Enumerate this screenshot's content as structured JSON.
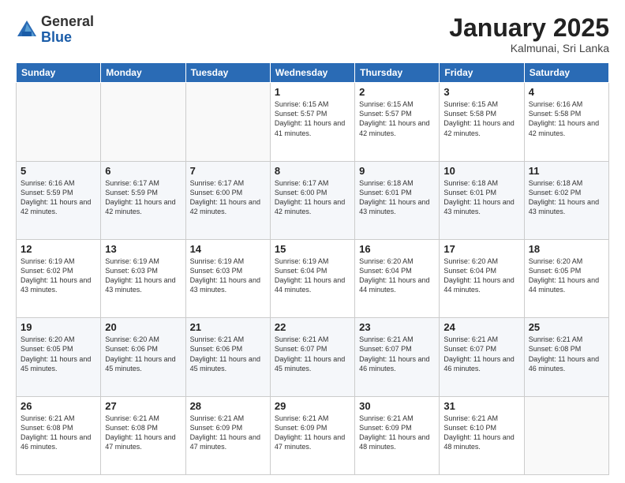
{
  "logo": {
    "general": "General",
    "blue": "Blue"
  },
  "header": {
    "month": "January 2025",
    "location": "Kalmunai, Sri Lanka"
  },
  "weekdays": [
    "Sunday",
    "Monday",
    "Tuesday",
    "Wednesday",
    "Thursday",
    "Friday",
    "Saturday"
  ],
  "weeks": [
    [
      {
        "day": "",
        "info": ""
      },
      {
        "day": "",
        "info": ""
      },
      {
        "day": "",
        "info": ""
      },
      {
        "day": "1",
        "info": "Sunrise: 6:15 AM\nSunset: 5:57 PM\nDaylight: 11 hours\nand 41 minutes."
      },
      {
        "day": "2",
        "info": "Sunrise: 6:15 AM\nSunset: 5:57 PM\nDaylight: 11 hours\nand 42 minutes."
      },
      {
        "day": "3",
        "info": "Sunrise: 6:15 AM\nSunset: 5:58 PM\nDaylight: 11 hours\nand 42 minutes."
      },
      {
        "day": "4",
        "info": "Sunrise: 6:16 AM\nSunset: 5:58 PM\nDaylight: 11 hours\nand 42 minutes."
      }
    ],
    [
      {
        "day": "5",
        "info": "Sunrise: 6:16 AM\nSunset: 5:59 PM\nDaylight: 11 hours\nand 42 minutes."
      },
      {
        "day": "6",
        "info": "Sunrise: 6:17 AM\nSunset: 5:59 PM\nDaylight: 11 hours\nand 42 minutes."
      },
      {
        "day": "7",
        "info": "Sunrise: 6:17 AM\nSunset: 6:00 PM\nDaylight: 11 hours\nand 42 minutes."
      },
      {
        "day": "8",
        "info": "Sunrise: 6:17 AM\nSunset: 6:00 PM\nDaylight: 11 hours\nand 42 minutes."
      },
      {
        "day": "9",
        "info": "Sunrise: 6:18 AM\nSunset: 6:01 PM\nDaylight: 11 hours\nand 43 minutes."
      },
      {
        "day": "10",
        "info": "Sunrise: 6:18 AM\nSunset: 6:01 PM\nDaylight: 11 hours\nand 43 minutes."
      },
      {
        "day": "11",
        "info": "Sunrise: 6:18 AM\nSunset: 6:02 PM\nDaylight: 11 hours\nand 43 minutes."
      }
    ],
    [
      {
        "day": "12",
        "info": "Sunrise: 6:19 AM\nSunset: 6:02 PM\nDaylight: 11 hours\nand 43 minutes."
      },
      {
        "day": "13",
        "info": "Sunrise: 6:19 AM\nSunset: 6:03 PM\nDaylight: 11 hours\nand 43 minutes."
      },
      {
        "day": "14",
        "info": "Sunrise: 6:19 AM\nSunset: 6:03 PM\nDaylight: 11 hours\nand 43 minutes."
      },
      {
        "day": "15",
        "info": "Sunrise: 6:19 AM\nSunset: 6:04 PM\nDaylight: 11 hours\nand 44 minutes."
      },
      {
        "day": "16",
        "info": "Sunrise: 6:20 AM\nSunset: 6:04 PM\nDaylight: 11 hours\nand 44 minutes."
      },
      {
        "day": "17",
        "info": "Sunrise: 6:20 AM\nSunset: 6:04 PM\nDaylight: 11 hours\nand 44 minutes."
      },
      {
        "day": "18",
        "info": "Sunrise: 6:20 AM\nSunset: 6:05 PM\nDaylight: 11 hours\nand 44 minutes."
      }
    ],
    [
      {
        "day": "19",
        "info": "Sunrise: 6:20 AM\nSunset: 6:05 PM\nDaylight: 11 hours\nand 45 minutes."
      },
      {
        "day": "20",
        "info": "Sunrise: 6:20 AM\nSunset: 6:06 PM\nDaylight: 11 hours\nand 45 minutes."
      },
      {
        "day": "21",
        "info": "Sunrise: 6:21 AM\nSunset: 6:06 PM\nDaylight: 11 hours\nand 45 minutes."
      },
      {
        "day": "22",
        "info": "Sunrise: 6:21 AM\nSunset: 6:07 PM\nDaylight: 11 hours\nand 45 minutes."
      },
      {
        "day": "23",
        "info": "Sunrise: 6:21 AM\nSunset: 6:07 PM\nDaylight: 11 hours\nand 46 minutes."
      },
      {
        "day": "24",
        "info": "Sunrise: 6:21 AM\nSunset: 6:07 PM\nDaylight: 11 hours\nand 46 minutes."
      },
      {
        "day": "25",
        "info": "Sunrise: 6:21 AM\nSunset: 6:08 PM\nDaylight: 11 hours\nand 46 minutes."
      }
    ],
    [
      {
        "day": "26",
        "info": "Sunrise: 6:21 AM\nSunset: 6:08 PM\nDaylight: 11 hours\nand 46 minutes."
      },
      {
        "day": "27",
        "info": "Sunrise: 6:21 AM\nSunset: 6:08 PM\nDaylight: 11 hours\nand 47 minutes."
      },
      {
        "day": "28",
        "info": "Sunrise: 6:21 AM\nSunset: 6:09 PM\nDaylight: 11 hours\nand 47 minutes."
      },
      {
        "day": "29",
        "info": "Sunrise: 6:21 AM\nSunset: 6:09 PM\nDaylight: 11 hours\nand 47 minutes."
      },
      {
        "day": "30",
        "info": "Sunrise: 6:21 AM\nSunset: 6:09 PM\nDaylight: 11 hours\nand 48 minutes."
      },
      {
        "day": "31",
        "info": "Sunrise: 6:21 AM\nSunset: 6:10 PM\nDaylight: 11 hours\nand 48 minutes."
      },
      {
        "day": "",
        "info": ""
      }
    ]
  ]
}
